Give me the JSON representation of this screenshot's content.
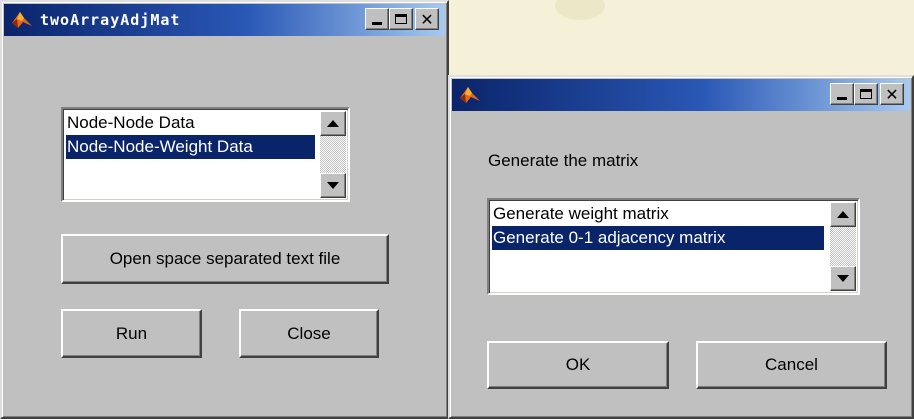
{
  "window1": {
    "title": "twoArrayAdjMat",
    "listbox": {
      "items": [
        {
          "label": "Node-Node Data",
          "selected": false
        },
        {
          "label": "Node-Node-Weight Data",
          "selected": true
        }
      ]
    },
    "open_button": "Open space separated text file",
    "run_button": "Run",
    "close_button": "Close"
  },
  "window2": {
    "title": "",
    "prompt": "Generate the matrix",
    "listbox": {
      "items": [
        {
          "label": "Generate weight matrix",
          "selected": false
        },
        {
          "label": "Generate 0-1 adjacency matrix",
          "selected": true
        }
      ]
    },
    "ok_button": "OK",
    "cancel_button": "Cancel"
  },
  "colors": {
    "titlebar_start": "#0a246a",
    "selection": "#0a246a",
    "window_face": "#c0c0c0",
    "desktop": "#f4f1d8"
  },
  "icons": {
    "app_icon": "matlab-logo-icon",
    "minimize": "minimize-icon",
    "maximize": "maximize-icon",
    "close": "close-icon",
    "scroll_up": "arrow-up-icon",
    "scroll_down": "arrow-down-icon"
  }
}
